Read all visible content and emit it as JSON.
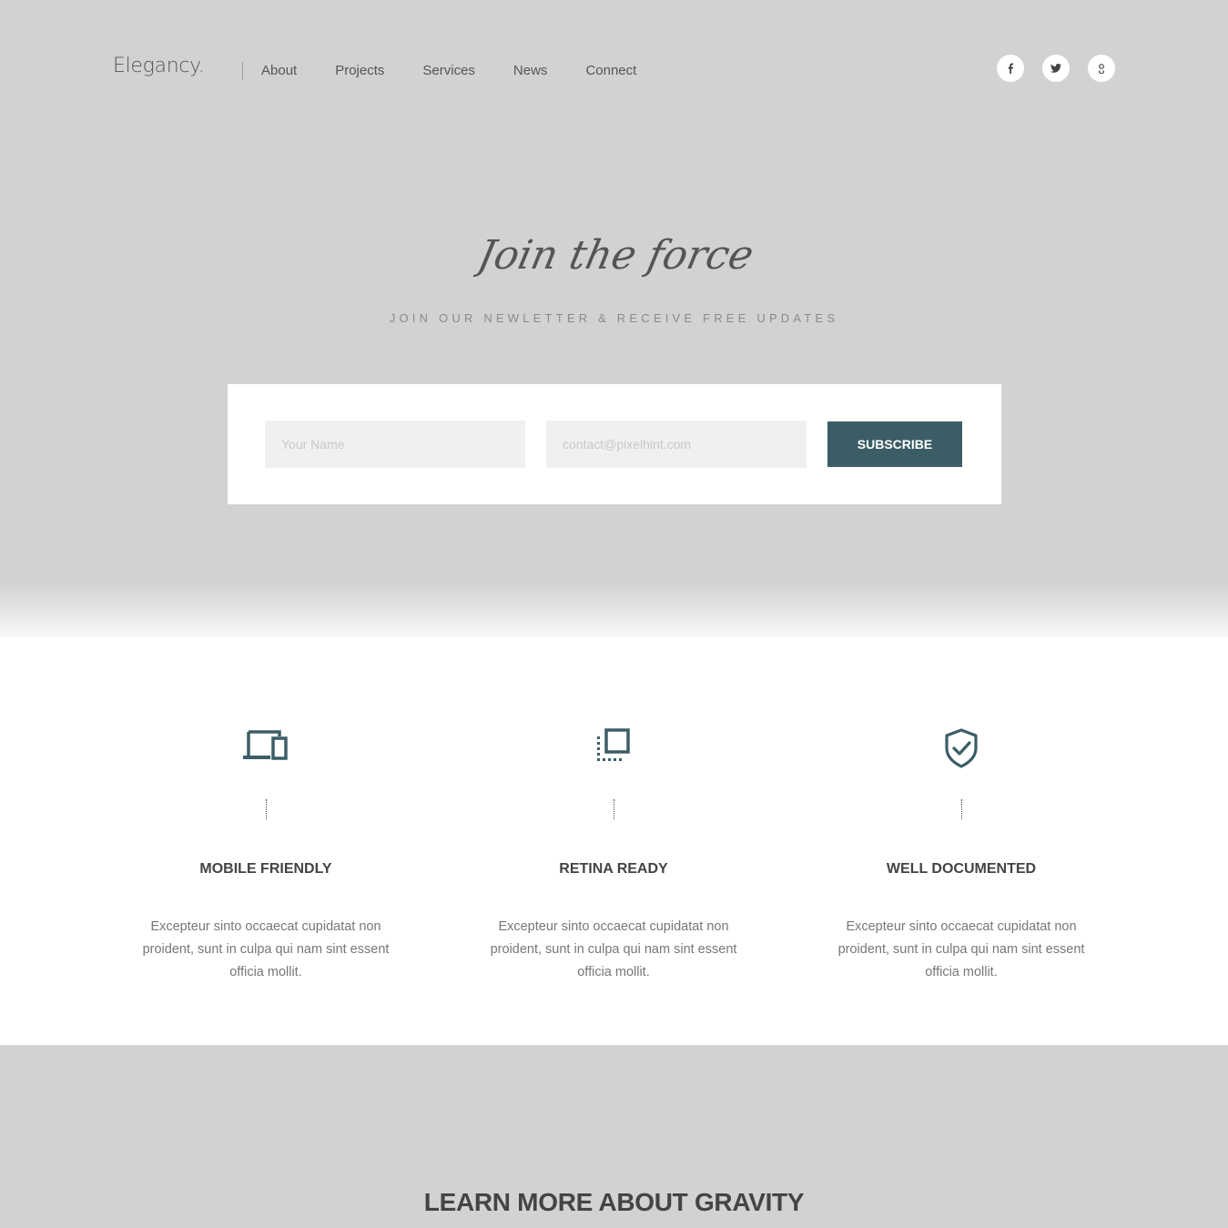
{
  "header": {
    "logo": "Elegancy.",
    "nav": [
      "About",
      "Projects",
      "Services",
      "News",
      "Connect"
    ],
    "social": [
      {
        "icon": "facebook-icon"
      },
      {
        "icon": "twitter-icon"
      },
      {
        "icon": "google-plus-icon"
      }
    ]
  },
  "hero": {
    "script_title": "Join the force",
    "subtitle": "JOIN OUR NEWLETTER & RECEIVE FREE UPDATES",
    "name_placeholder": "Your Name",
    "email_placeholder": "contact@pixelhint.com",
    "subscribe_label": "SUBSCRIBE"
  },
  "features": [
    {
      "icon": "devices-icon",
      "title": "MOBILE FRIENDLY",
      "text": "Excepteur sinto occaecat cupidatat non proident, sunt in culpa qui nam sint essent officia mollit."
    },
    {
      "icon": "retina-icon",
      "title": "RETINA READY",
      "text": "Excepteur sinto occaecat cupidatat non proident, sunt in culpa qui nam sint essent officia mollit."
    },
    {
      "icon": "shield-check-icon",
      "title": "WELL DOCUMENTED",
      "text": "Excepteur sinto occaecat cupidatat non proident, sunt in culpa qui nam sint essent officia mollit."
    }
  ],
  "learn_more": "LEARN MORE ABOUT GRAVITY",
  "colors": {
    "accent": "#3b5e66",
    "background": "#d2d2d2",
    "panel": "#ffffff"
  }
}
